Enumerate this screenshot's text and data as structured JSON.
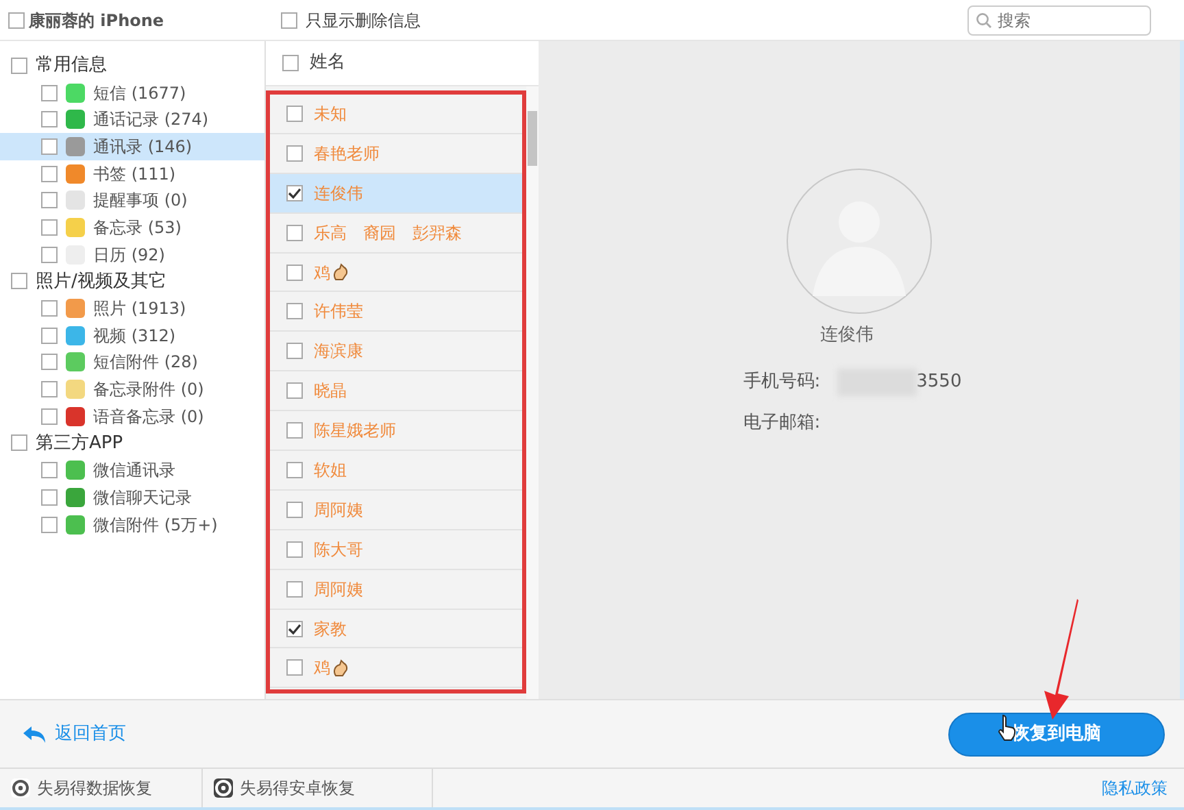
{
  "device": {
    "label": "康丽蓉的 iPhone",
    "checked": false
  },
  "filter": {
    "label": "只显示删除信息",
    "checked": false
  },
  "search": {
    "placeholder": "搜索"
  },
  "sidebar": {
    "groups": [
      {
        "label": "常用信息",
        "checked": false,
        "children": [
          {
            "label": "短信 (1677)",
            "checked": false,
            "selected": false,
            "color": "#4cd964"
          },
          {
            "label": "通话记录 (274)",
            "checked": false,
            "selected": false,
            "color": "#2fb84a"
          },
          {
            "label": "通讯录 (146)",
            "checked": false,
            "selected": true,
            "color": "#9a9a9a"
          },
          {
            "label": "书签 (111)",
            "checked": false,
            "selected": false,
            "color": "#f0892a"
          },
          {
            "label": "提醒事项 (0)",
            "checked": false,
            "selected": false,
            "color": "#e4e4e4"
          },
          {
            "label": "备忘录 (53)",
            "checked": false,
            "selected": false,
            "color": "#f5d04a"
          },
          {
            "label": "日历 (92)",
            "checked": false,
            "selected": false,
            "color": "#eeeeee"
          }
        ]
      },
      {
        "label": "照片/视频及其它",
        "checked": false,
        "children": [
          {
            "label": "照片 (1913)",
            "checked": false,
            "selected": false,
            "color": "#f29a4a"
          },
          {
            "label": "视频 (312)",
            "checked": false,
            "selected": false,
            "color": "#3cb6e8"
          },
          {
            "label": "短信附件 (28)",
            "checked": false,
            "selected": false,
            "color": "#5ccb5f"
          },
          {
            "label": "备忘录附件 (0)",
            "checked": false,
            "selected": false,
            "color": "#f3d880"
          },
          {
            "label": "语音备忘录 (0)",
            "checked": false,
            "selected": false,
            "color": "#d9342b"
          }
        ]
      },
      {
        "label": "第三方APP",
        "checked": false,
        "children": [
          {
            "label": "微信通讯录",
            "checked": false,
            "selected": false,
            "color": "#4cbf4f"
          },
          {
            "label": "微信聊天记录",
            "checked": false,
            "selected": false,
            "color": "#3aa63c"
          },
          {
            "label": "微信附件 (5万+)",
            "checked": false,
            "selected": false,
            "color": "#4cbf4f"
          }
        ]
      }
    ]
  },
  "contacts": {
    "header": {
      "label": "姓名",
      "checked": false
    },
    "rows": [
      {
        "name": "未知",
        "checked": false,
        "selected": false,
        "emoji": false
      },
      {
        "name": "春艳老师",
        "checked": false,
        "selected": false,
        "emoji": false
      },
      {
        "name": "连俊伟",
        "checked": true,
        "selected": true,
        "emoji": false
      },
      {
        "name": "乐高　裔园　彭羿森",
        "checked": false,
        "selected": false,
        "emoji": false
      },
      {
        "name": "鸡",
        "checked": false,
        "selected": false,
        "emoji": true
      },
      {
        "name": "许伟莹",
        "checked": false,
        "selected": false,
        "emoji": false
      },
      {
        "name": "海滨康",
        "checked": false,
        "selected": false,
        "emoji": false
      },
      {
        "name": "晓晶",
        "checked": false,
        "selected": false,
        "emoji": false
      },
      {
        "name": "陈星娥老师",
        "checked": false,
        "selected": false,
        "emoji": false
      },
      {
        "name": "软姐",
        "checked": false,
        "selected": false,
        "emoji": false
      },
      {
        "name": "周阿姨",
        "checked": false,
        "selected": false,
        "emoji": false
      },
      {
        "name": "陈大哥",
        "checked": false,
        "selected": false,
        "emoji": false
      },
      {
        "name": "周阿姨",
        "checked": false,
        "selected": false,
        "emoji": false
      },
      {
        "name": "家教",
        "checked": true,
        "selected": false,
        "emoji": false
      },
      {
        "name": "鸡",
        "checked": false,
        "selected": false,
        "emoji": true
      }
    ]
  },
  "detail": {
    "name": "连俊伟",
    "fields": [
      {
        "label": "手机号码:",
        "value": "3550"
      },
      {
        "label": "电子邮箱:"
      }
    ]
  },
  "toolbar": {
    "back": "返回首页",
    "restore": "恢复到电脑"
  },
  "footer": {
    "links": [
      "失易得数据恢复",
      "失易得安卓恢复"
    ],
    "privacy": "隐私政策"
  }
}
